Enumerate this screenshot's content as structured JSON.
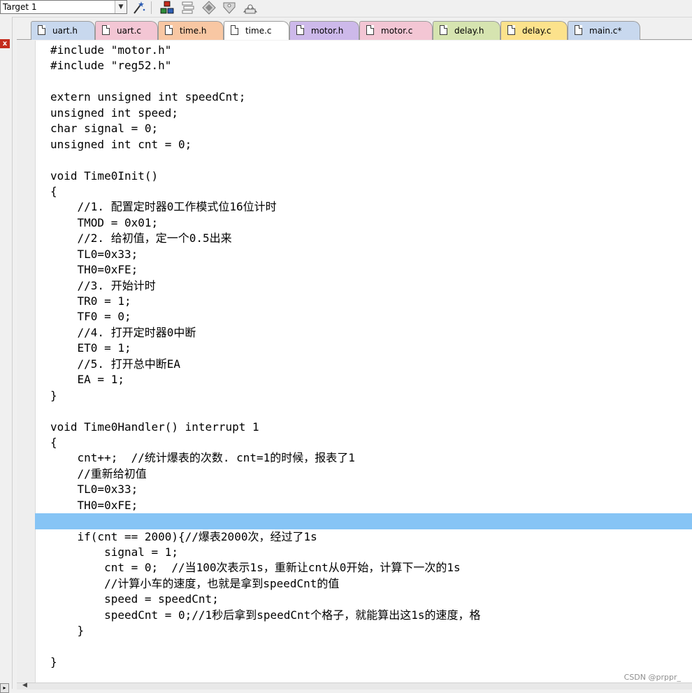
{
  "toolbar": {
    "target_label": "Target 1",
    "icons": [
      "wand-icon",
      "component-icon",
      "layers-icon",
      "diamond-icon",
      "tag-icon",
      "books-icon"
    ]
  },
  "left_panel": {
    "close_glyph": "x",
    "scroll_glyph": "▸"
  },
  "tabs": [
    {
      "label": "uart.h",
      "color": "#c8d8ee",
      "active": false
    },
    {
      "label": "uart.c",
      "color": "#f3c6d4",
      "active": false
    },
    {
      "label": "time.h",
      "color": "#f8c7a3",
      "active": false
    },
    {
      "label": "time.c",
      "color": "#ffffff",
      "active": true
    },
    {
      "label": "motor.h",
      "color": "#cdb9ea",
      "active": false
    },
    {
      "label": "motor.c",
      "color": "#f3c6d4",
      "active": false
    },
    {
      "label": "delay.h",
      "color": "#d6e4b0",
      "active": false
    },
    {
      "label": "delay.c",
      "color": "#fce28c",
      "active": false
    },
    {
      "label": "main.c*",
      "color": "#c8d8ee",
      "active": false
    }
  ],
  "editor": {
    "highlight_color": "#86c4f5",
    "highlighted_line": 30,
    "lines": [
      "#include \"motor.h\"",
      "#include \"reg52.h\"",
      "",
      "extern unsigned int speedCnt;",
      "unsigned int speed;",
      "char signal = 0;",
      "unsigned int cnt = 0;",
      "",
      "void Time0Init()",
      "{",
      "    //1. 配置定时器0工作模式位16位计时",
      "    TMOD = 0x01;",
      "    //2. 给初值，定一个0.5出来",
      "    TL0=0x33;",
      "    TH0=0xFE;",
      "    //3. 开始计时",
      "    TR0 = 1;",
      "    TF0 = 0;",
      "    //4. 打开定时器0中断",
      "    ET0 = 1;",
      "    //5. 打开总中断EA",
      "    EA = 1;",
      "}",
      "",
      "void Time0Handler() interrupt 1",
      "{",
      "    cnt++;  //统计爆表的次数. cnt=1的时候，报表了1",
      "    //重新给初值",
      "    TL0=0x33;",
      "    TH0=0xFE;",
      "",
      "    if(cnt == 2000){//爆表2000次，经过了1s",
      "        signal = 1;",
      "        cnt = 0;  //当100次表示1s，重新让cnt从0开始，计算下一次的1s",
      "        //计算小车的速度，也就是拿到speedCnt的值",
      "        speed = speedCnt;",
      "        speedCnt = 0;//1秒后拿到speedCnt个格子，就能算出这1s的速度，格",
      "    }",
      "",
      "}"
    ]
  },
  "watermark": "CSDN @prppr_"
}
